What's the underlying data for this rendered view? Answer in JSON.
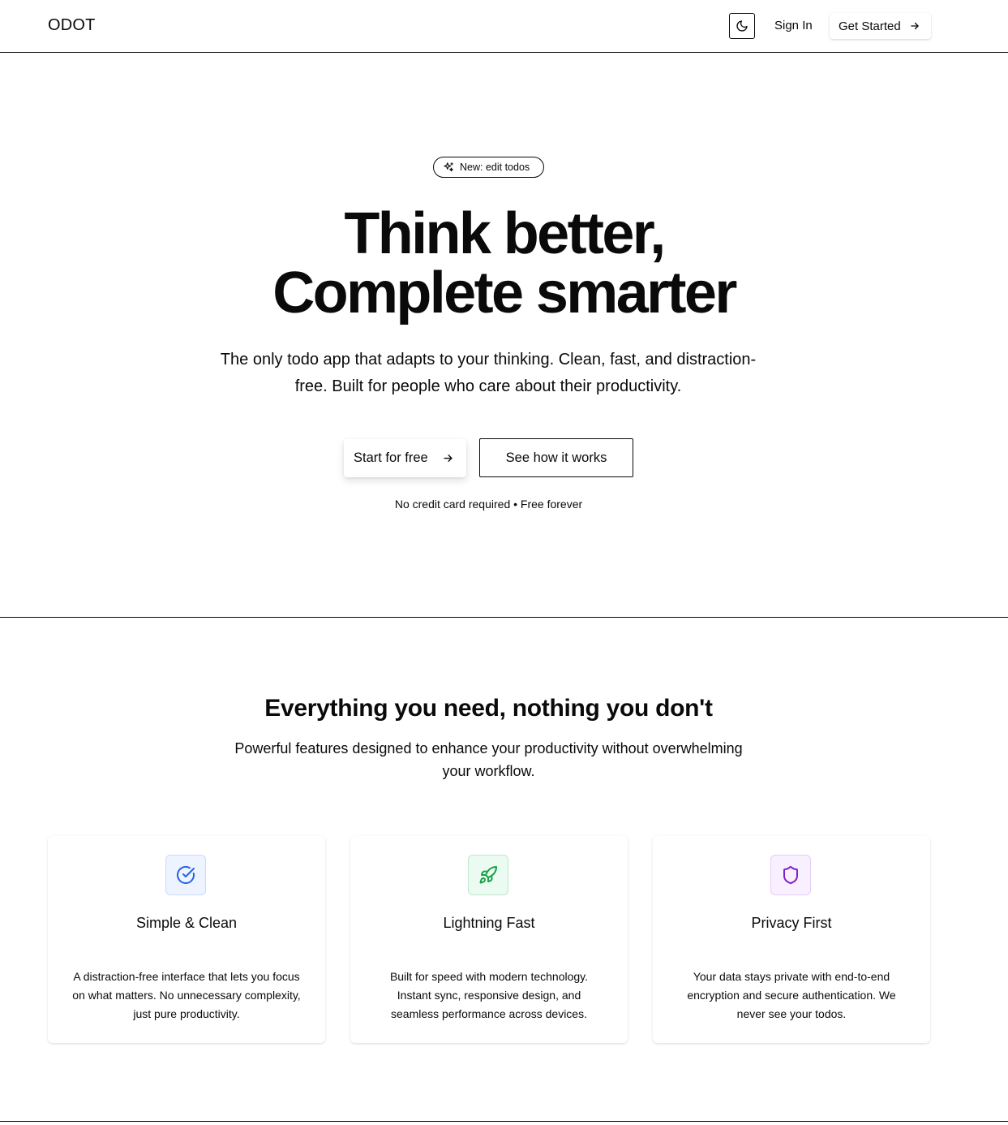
{
  "header": {
    "logo": "ODOT",
    "theme_toggle_icon": "moon-icon",
    "sign_in": "Sign In",
    "get_started": "Get Started"
  },
  "hero": {
    "badge": "New: edit todos",
    "title_line1": "Think better,",
    "title_line2": "Complete smarter",
    "subtitle": "The only todo app that adapts to your thinking. Clean, fast, and distraction-free. Built for people who care about their productivity.",
    "primary_cta": "Start for free",
    "secondary_cta": "See how it works",
    "note": "No credit card required • Free forever"
  },
  "features": {
    "title": "Everything you need, nothing you don't",
    "subtitle": "Powerful features designed to enhance your productivity without overwhelming your workflow.",
    "cards": [
      {
        "icon": "check-circle-icon",
        "title": "Simple & Clean",
        "description": "A distraction-free interface that lets you focus on what matters. No unnecessary complexity, just pure productivity.",
        "accent": "#2563eb",
        "bg": "#eef4ff"
      },
      {
        "icon": "rocket-icon",
        "title": "Lightning Fast",
        "description": "Built for speed with modern technology. Instant sync, responsive design, and seamless performance across devices.",
        "accent": "#16a34a",
        "bg": "#ecfbf1"
      },
      {
        "icon": "shield-icon",
        "title": "Privacy First",
        "description": "Your data stays private with end-to-end encryption and secure authentication. We never see your todos.",
        "accent": "#7e22ce",
        "bg": "#f8efff"
      }
    ]
  }
}
